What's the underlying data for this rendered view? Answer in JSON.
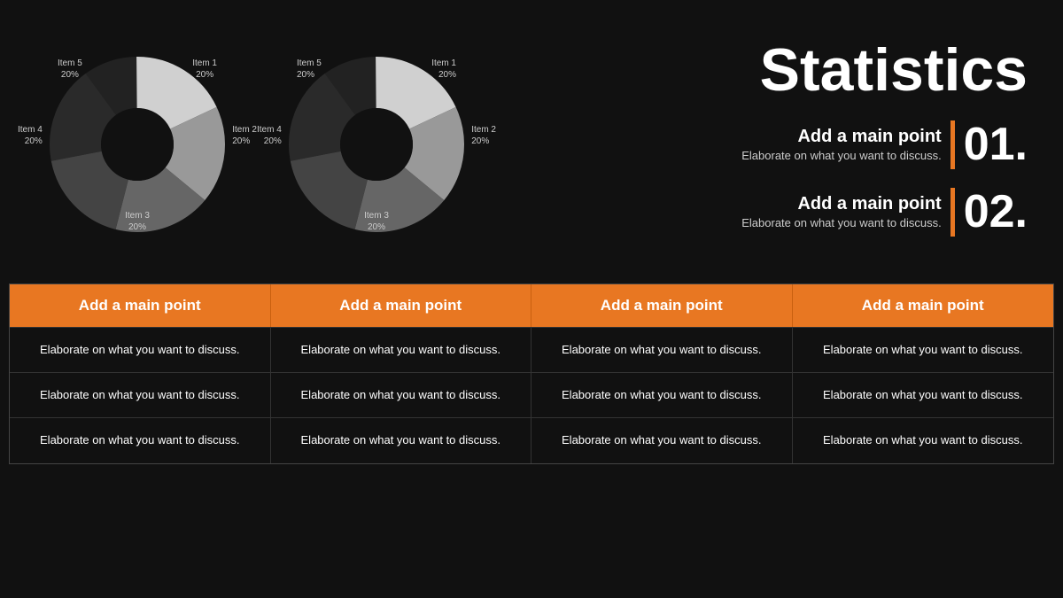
{
  "title": "Statistics",
  "chart1": {
    "items": [
      {
        "label": "Item 1",
        "pct": "20%",
        "color": "#e8e8e8",
        "startAngle": 0,
        "endAngle": 72
      },
      {
        "label": "Item 2",
        "pct": "20%",
        "color": "#aaaaaa",
        "startAngle": 72,
        "endAngle": 144
      },
      {
        "label": "Item 3",
        "pct": "20%",
        "color": "#777777",
        "startAngle": 144,
        "endAngle": 216
      },
      {
        "label": "Item 4",
        "pct": "20%",
        "color": "#555555",
        "startAngle": 216,
        "endAngle": 288
      },
      {
        "label": "Item 5",
        "pct": "20%",
        "color": "#333333",
        "startAngle": 288,
        "endAngle": 360
      }
    ]
  },
  "chart2": {
    "items": [
      {
        "label": "Item 1",
        "pct": "20%",
        "color": "#e8e8e8"
      },
      {
        "label": "Item 2",
        "pct": "20%",
        "color": "#aaaaaa"
      },
      {
        "label": "Item 3",
        "pct": "20%",
        "color": "#777777"
      },
      {
        "label": "Item 4",
        "pct": "20%",
        "color": "#555555"
      },
      {
        "label": "Item 5",
        "pct": "20%",
        "color": "#333333"
      }
    ]
  },
  "points": [
    {
      "title": "Add a main point",
      "desc": "Elaborate on what you want to discuss.",
      "number": "01."
    },
    {
      "title": "Add a main point",
      "desc": "Elaborate on what you want to discuss.",
      "number": "02."
    }
  ],
  "table": {
    "headers": [
      "Add a main point",
      "Add a main point",
      "Add a main point",
      "Add a main point"
    ],
    "rows": [
      [
        "Elaborate on what you want to discuss.",
        "Elaborate on what you want to discuss.",
        "Elaborate on what you want to discuss.",
        "Elaborate on what you want to discuss."
      ],
      [
        "Elaborate on what you want to discuss.",
        "Elaborate on what you want to discuss.",
        "Elaborate on what you want to discuss.",
        "Elaborate on what you want to discuss."
      ],
      [
        "Elaborate on what you want to discuss.",
        "Elaborate on what you want to discuss.",
        "Elaborate on what you want to discuss.",
        "Elaborate on what you want to discuss."
      ]
    ]
  }
}
